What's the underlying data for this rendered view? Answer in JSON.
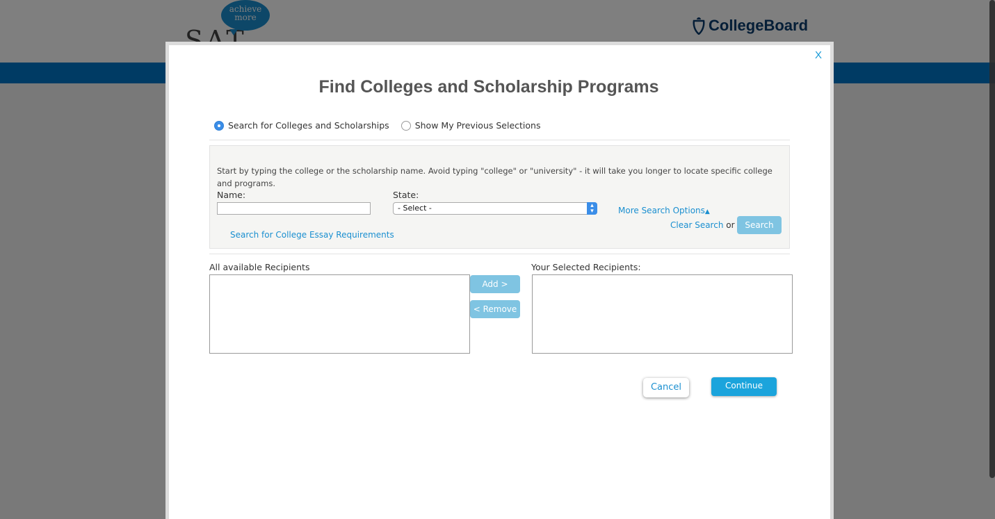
{
  "background": {
    "sat_logo_text": "SAT",
    "sat_bubble_line1": "achieve",
    "sat_bubble_line2": "more",
    "collegeboard_logo_text": "CollegeBoard"
  },
  "modal": {
    "close_label": "X",
    "title": "Find Colleges and Scholarship Programs",
    "radio_options": [
      {
        "label": "Search for Colleges and Scholarships",
        "selected": true
      },
      {
        "label": "Show My Previous Selections",
        "selected": false
      }
    ],
    "search_panel": {
      "instructions": "Start by typing the college or the scholarship name. Avoid typing \"college\" or \"university\" - it will take you longer to locate specific college and programs.",
      "name_label": "Name:",
      "name_value": "",
      "state_label": "State:",
      "state_selected": "- Select -",
      "more_search_options": "More Search Options",
      "essay_link": "Search for College Essay Requirements",
      "clear_search": "Clear Search",
      "or_text": "or",
      "search_button": "Search"
    },
    "recipients": {
      "available_label": "All available Recipients",
      "selected_label": "Your Selected Recipients:",
      "add_button": "Add >",
      "remove_button": "< Remove"
    },
    "cancel_button": "Cancel",
    "continue_button": "Continue"
  },
  "colors": {
    "accent": "#1a8fd0",
    "button_light": "#7fc4e2",
    "continue": "#1ba4dc",
    "bluebar": "#0077c8"
  }
}
